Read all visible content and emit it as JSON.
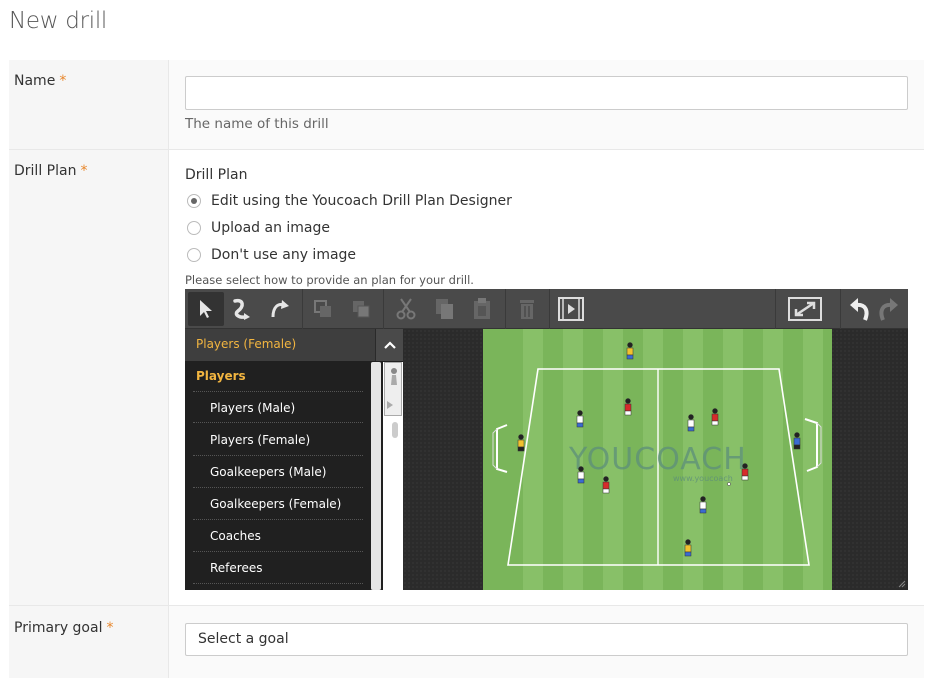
{
  "page": {
    "title": "New drill"
  },
  "name_field": {
    "label": "Name",
    "required_mark": "*",
    "value": "",
    "placeholder": "",
    "help": "The name of this drill"
  },
  "drill_plan": {
    "label": "Drill Plan",
    "required_mark": "*",
    "heading": "Drill Plan",
    "options": [
      {
        "label": "Edit using the Youcoach Drill Plan Designer",
        "checked": true
      },
      {
        "label": "Upload an image",
        "checked": false
      },
      {
        "label": "Don't use any image",
        "checked": false
      }
    ],
    "help": "Please select how to provide an plan for your drill."
  },
  "designer": {
    "toolbar_icons": [
      "select-arrow-icon",
      "curved-arrow-icon",
      "arc-arrow-icon",
      "bring-forward-icon",
      "send-backward-icon",
      "cut-icon",
      "copy-icon",
      "paste-icon",
      "delete-icon",
      "animation-film-icon",
      "fullscreen-icon",
      "undo-icon",
      "redo-icon"
    ],
    "panel_header": "Players (Female)",
    "category": "Players",
    "items": [
      "Players (Male)",
      "Players (Female)",
      "Goalkeepers (Male)",
      "Goalkeepers (Female)",
      "Coaches",
      "Referees"
    ],
    "watermark": "YOUCOACH",
    "watermark_url": "www.youcoach",
    "colors": {
      "accent": "#f2b540",
      "pitch": "#7cb35b",
      "team_red": "#d62b2b",
      "team_white": "#ffffff",
      "goalkeeper": "#f2c12e"
    }
  },
  "primary_goal": {
    "label": "Primary goal",
    "required_mark": "*",
    "selected": "Select a goal"
  }
}
